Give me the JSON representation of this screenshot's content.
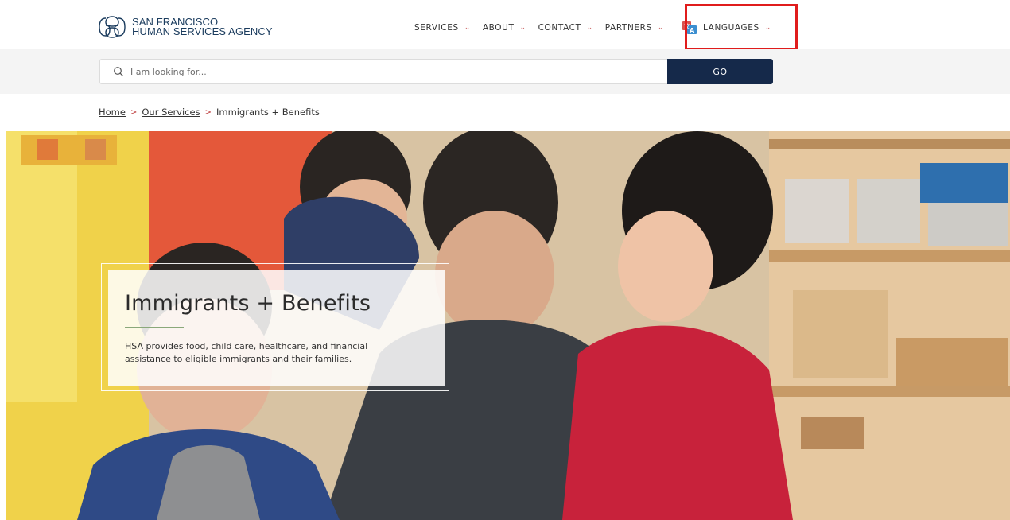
{
  "brand": {
    "line1": "SAN FRANCISCO",
    "line2": "HUMAN SERVICES AGENCY"
  },
  "nav": {
    "items": [
      {
        "label": "SERVICES"
      },
      {
        "label": "ABOUT"
      },
      {
        "label": "CONTACT"
      },
      {
        "label": "PARTNERS"
      },
      {
        "label": "LANGUAGES"
      }
    ],
    "chevron": "⌄"
  },
  "search": {
    "placeholder": "I am looking for...",
    "value": "",
    "button_label": "GO"
  },
  "breadcrumb": {
    "home": "Home",
    "sep": ">",
    "services": "Our Services",
    "current": "Immigrants + Benefits"
  },
  "hero": {
    "title": "Immigrants + Benefits",
    "description": "HSA provides food, child care, healthcare, and financial assistance to eligible immigrants and their families."
  },
  "colors": {
    "brand_navy": "#15294a",
    "chevron_red": "#c24a4a",
    "highlight_red": "#e01c1c",
    "accent_green": "#8aa87a"
  },
  "icons": {
    "logo": "logo-mark-icon",
    "languages": "translate-icon",
    "search": "search-icon"
  }
}
